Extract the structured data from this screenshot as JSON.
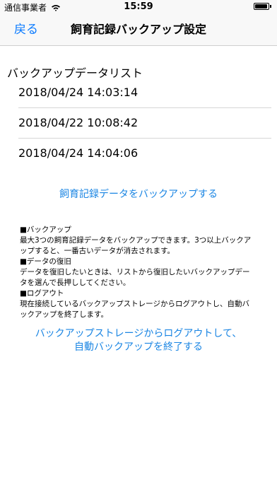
{
  "status_bar": {
    "carrier": "通信事業者",
    "time": "15:59",
    "wifi_icon": "wifi-icon",
    "battery_icon": "battery-icon",
    "battery_level": 0.95
  },
  "nav": {
    "back_label": "戻る",
    "title": "飼育記録バックアップ設定"
  },
  "backup_list": {
    "title": "バックアップデータリスト",
    "items": [
      "2018/04/24 14:03:14",
      "2018/04/22 10:08:42",
      "2018/04/24 14:04:06"
    ]
  },
  "backup_button_label": "飼育記録データをバックアップする",
  "help": {
    "lines": [
      "■バックアップ",
      "最大3つの飼育記録データをバックアップできます。3つ以上バックア",
      "ップすると、一番古いデータが消去されます。",
      "■データの復旧",
      "データを復旧したいときは、リストから復旧したいバックアップデー",
      "タを選んで長押ししてください。",
      "■ログアウト",
      "現在接続しているバックアップストレージからログアウトし、自動バ",
      "ックアップを終了します。"
    ]
  },
  "logout_button": {
    "line1": "バックアップストレージからログアウトして、",
    "line2": "自動バックアップを終了する"
  }
}
